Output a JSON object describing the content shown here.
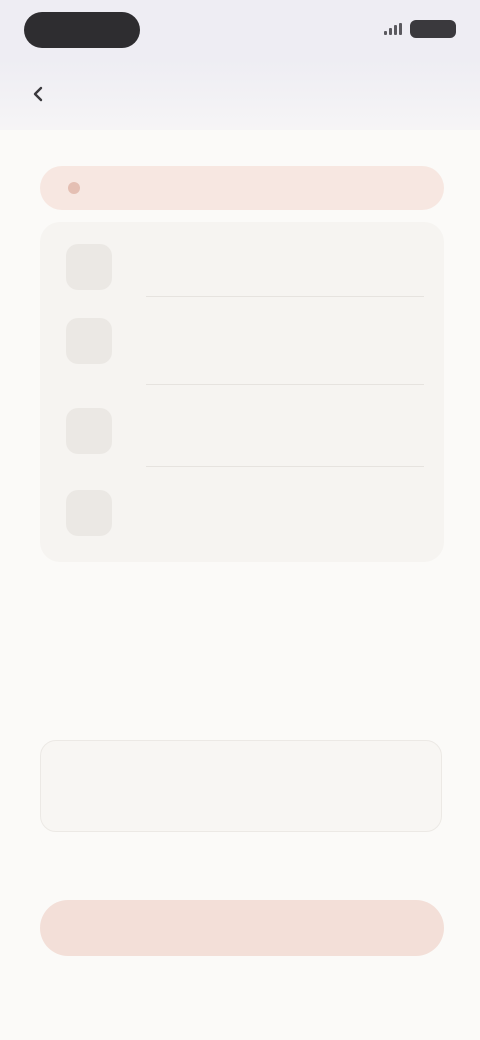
{
  "status_bar": {
    "time": ""
  },
  "header": {
    "title": ""
  },
  "section": {
    "caption": ""
  },
  "warning": {
    "text": ""
  },
  "options": [
    {
      "icon": "shield-icon",
      "title": "",
      "subtitle": ""
    },
    {
      "icon": "doc-icon",
      "title": "",
      "subtitle": ""
    },
    {
      "icon": "lock-icon",
      "title": "",
      "subtitle": ""
    },
    {
      "icon": "person-icon",
      "title": "",
      "subtitle": ""
    }
  ],
  "info": {
    "label": "",
    "heading": "",
    "description": ""
  },
  "input": {
    "value": ""
  },
  "primary_button": {
    "label": ""
  },
  "colors": {
    "accent": "#f3dfd8",
    "warning_bg": "#f7e7e1",
    "background": "#fbfaf8"
  }
}
